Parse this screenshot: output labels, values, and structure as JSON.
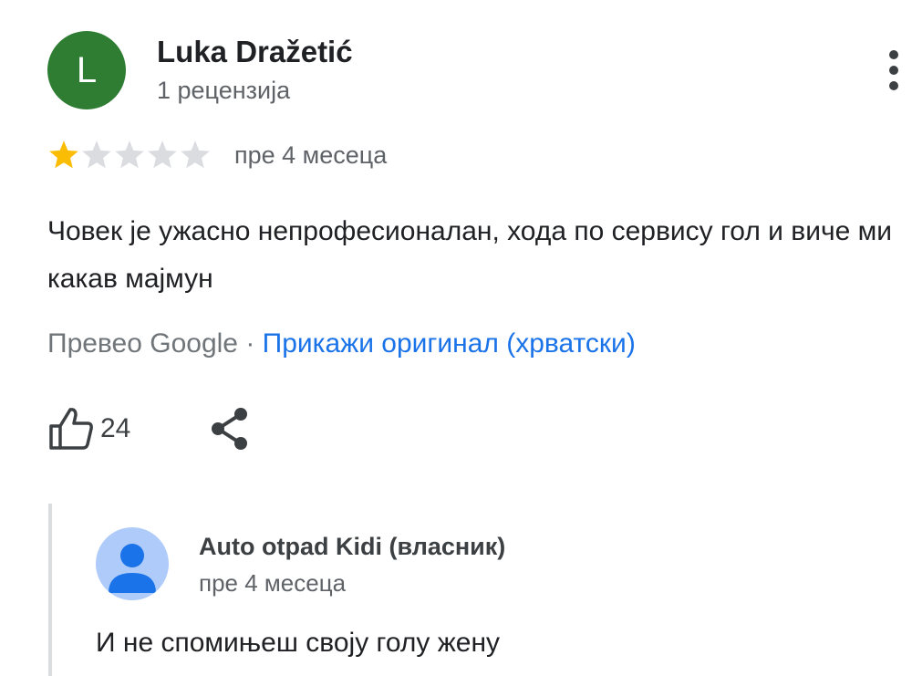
{
  "review": {
    "avatar_letter": "L",
    "avatar_color": "#2e7d32",
    "author": "Luka Dražetić",
    "author_reviews": "1 рецензија",
    "rating": 1,
    "rating_max": 5,
    "time": "пре 4 месеца",
    "text": "Човек је ужасно непрофесионалан, хода по сервису гол и виче ми какав мајмун",
    "translated_by": "Превео Google",
    "separator": "·",
    "show_original": "Прикажи оригинал (хрватски)",
    "likes": "24",
    "icons": {
      "more": "more-vert-icon",
      "like": "thumb-up-outline-icon",
      "share": "share-icon"
    }
  },
  "owner_reply": {
    "name": "Auto otpad Kidi (власник)",
    "time": "пре 4 месеца",
    "text": "И не спомињеш своју голу жену",
    "avatar_icon": "person-icon",
    "avatar_bg": "#aecbfa"
  },
  "colors": {
    "link": "#1a73e8",
    "star_filled": "#fbbc04",
    "star_empty": "#dadce0"
  }
}
